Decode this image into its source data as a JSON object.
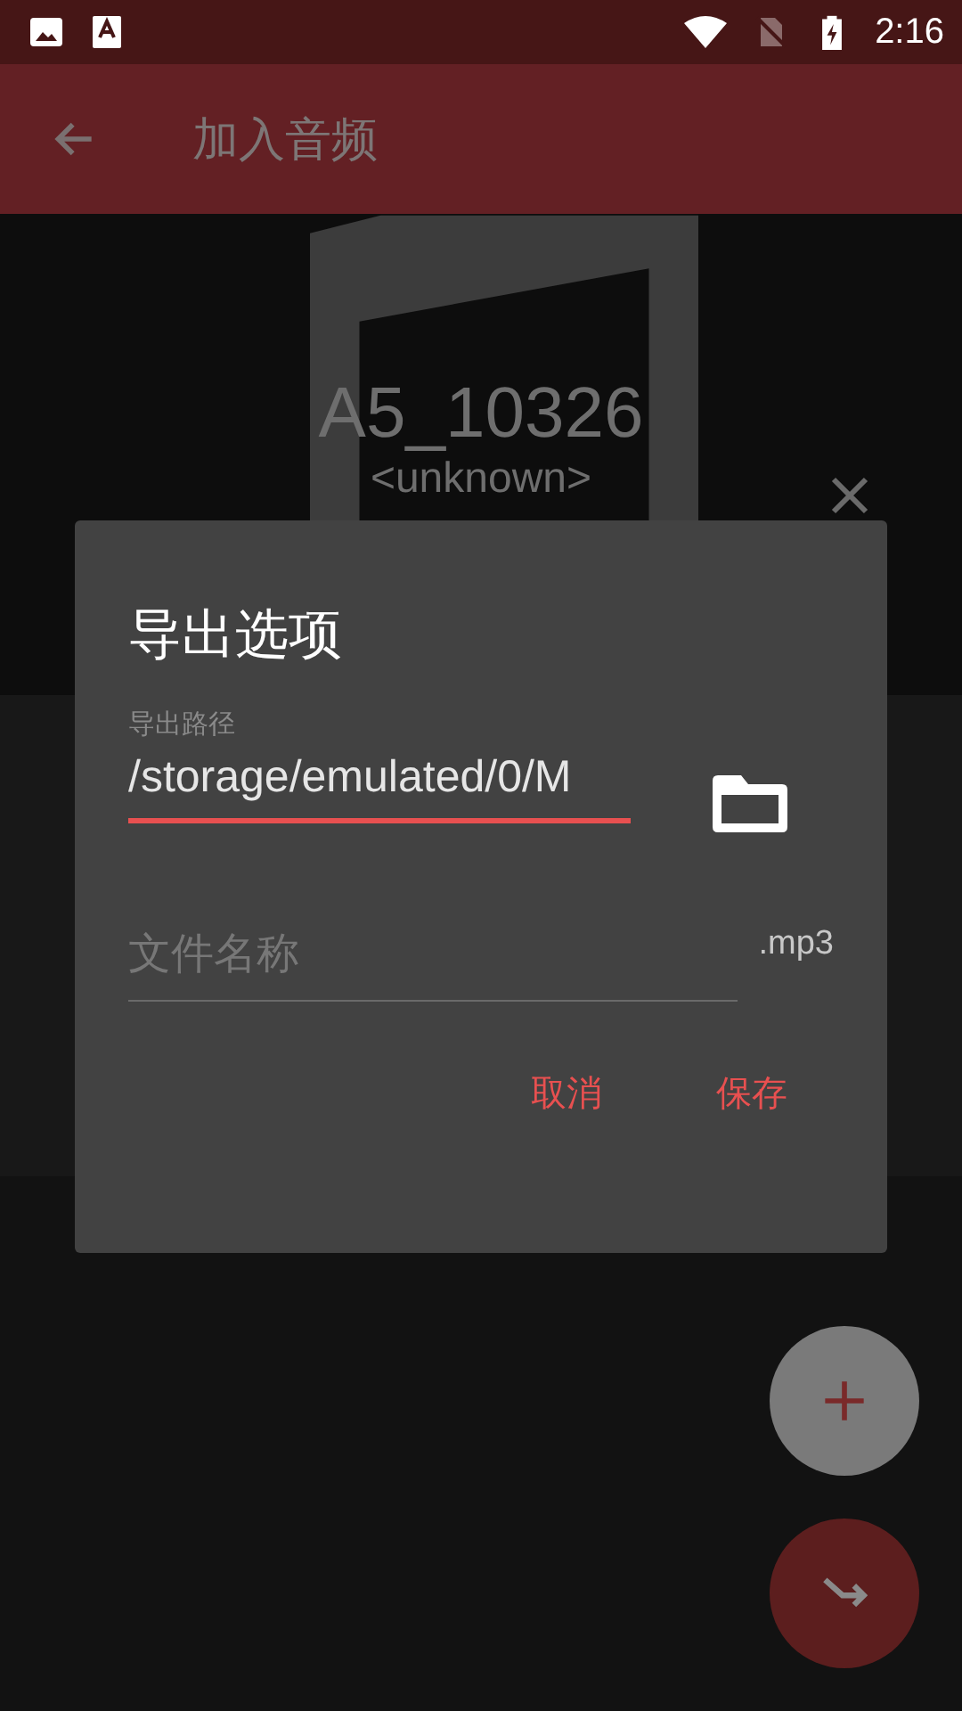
{
  "status_bar": {
    "time": "2:16"
  },
  "app_bar": {
    "title": "加入音频"
  },
  "track": {
    "title": "A5_10326",
    "artist": "<unknown>"
  },
  "dialog": {
    "title": "导出选项",
    "path_field": {
      "label": "导出路径",
      "value": "/storage/emulated/0/M",
      "focused": true
    },
    "name_field": {
      "placeholder": "文件名称",
      "extension": ".mp3",
      "focused": false
    },
    "buttons": [
      "取消",
      "保存"
    ]
  }
}
